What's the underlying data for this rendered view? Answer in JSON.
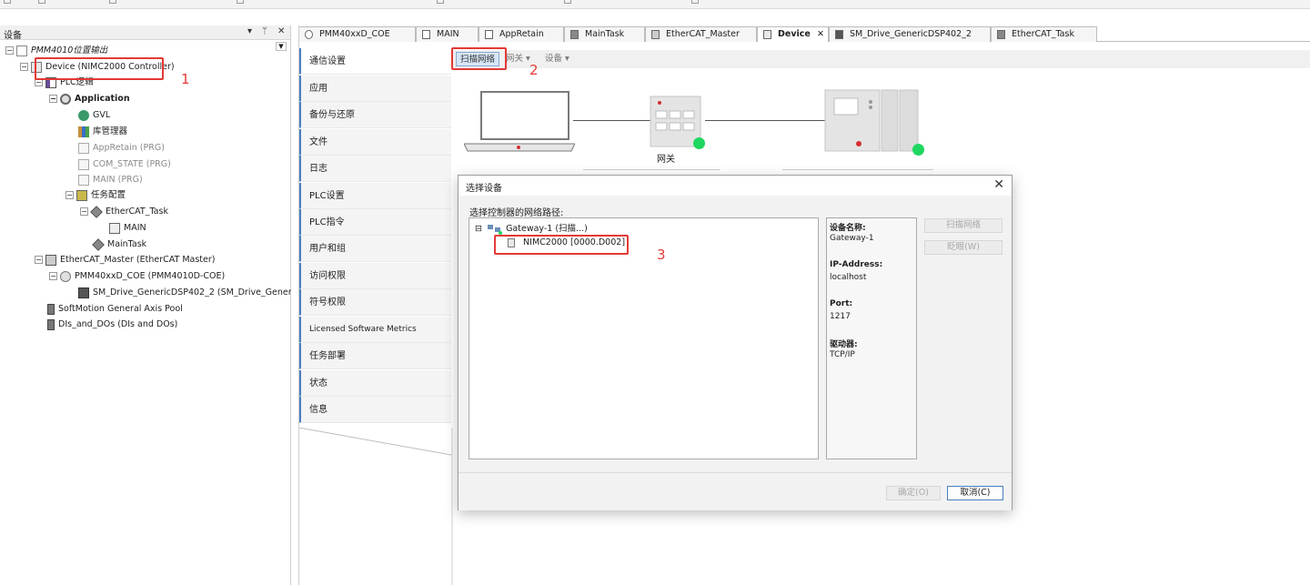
{
  "left_panel": {
    "title": "设备",
    "header_buttons": [
      "▾",
      "ᛘ",
      "✕"
    ],
    "tree": [
      {
        "label": "PMM4010位置输出",
        "style": "italic",
        "level": 0
      },
      {
        "label": "Device (NIMC2000 Controller)",
        "level": 1
      },
      {
        "label": "PLC逻辑",
        "level": 2
      },
      {
        "label": "Application",
        "level": 3,
        "style": "bold"
      },
      {
        "label": "GVL",
        "level": 4
      },
      {
        "label": "库管理器",
        "level": 4
      },
      {
        "label": "AppRetain (PRG)",
        "level": 4,
        "style": "gray"
      },
      {
        "label": "COM_STATE (PRG)",
        "level": 4,
        "style": "gray"
      },
      {
        "label": "MAIN (PRG)",
        "level": 4,
        "style": "gray"
      },
      {
        "label": "任务配置",
        "level": 4
      },
      {
        "label": "EtherCAT_Task",
        "level": 5
      },
      {
        "label": "MAIN",
        "level": 6
      },
      {
        "label": "MainTask",
        "level": 5
      },
      {
        "label": "EtherCAT_Master (EtherCAT Master)",
        "level": 1
      },
      {
        "label": "PMM40xxD_COE (PMM4010D-COE)",
        "level": 2
      },
      {
        "label": "SM_Drive_GenericDSP402_2 (SM_Drive_GenericDSP402)",
        "level": 3
      },
      {
        "label": "SoftMotion General Axis Pool",
        "level": 1
      },
      {
        "label": "DIs_and_DOs (DIs and DOs)",
        "level": 1
      }
    ]
  },
  "tabs": [
    {
      "label": "PMM40xxD_COE"
    },
    {
      "label": "MAIN"
    },
    {
      "label": "AppRetain"
    },
    {
      "label": "MainTask"
    },
    {
      "label": "EtherCAT_Master"
    },
    {
      "label": "Device",
      "active": true,
      "close": "✕"
    },
    {
      "label": "SM_Drive_GenericDSP402_2"
    },
    {
      "label": "EtherCAT_Task"
    }
  ],
  "nav_items": [
    "通信设置",
    "应用",
    "备份与还原",
    "文件",
    "日志",
    "PLC设置",
    "PLC指令",
    "用户和组",
    "访问权限",
    "符号权限",
    "Licensed Software Metrics",
    "任务部署",
    "状态",
    "信息"
  ],
  "toolbar": {
    "scan": "扫描网络",
    "gateway": "网关",
    "gateway_arrow": "▾",
    "device": "设备",
    "device_arrow": "▾"
  },
  "diagram": {
    "gateway_label": "网关"
  },
  "annotations": {
    "n1": "1",
    "n2": "2",
    "n3": "3"
  },
  "dialog": {
    "title": "选择设备",
    "close": "✕",
    "path_label": "选择控制器的网络路径:",
    "tree": {
      "gateway": "Gateway-1 (扫描...)",
      "device": "NIMC2000 [0000.D002]",
      "expander": "⊟"
    },
    "info": [
      {
        "key": "设备名称:",
        "value": "Gateway-1"
      },
      {
        "key": "IP-Address:",
        "value": "localhost"
      },
      {
        "key": "Port:",
        "value": "1217"
      },
      {
        "key": "驱动器:",
        "value": "TCP/IP"
      }
    ],
    "buttons": {
      "scan": "扫描网络",
      "wink": "眨眼(W)",
      "ok": "确定(O)",
      "cancel": "取消(C)"
    }
  },
  "colors": {
    "accent": "#4a7fc1",
    "annotation_red": "#e53935",
    "status_green": "#1ed760"
  }
}
